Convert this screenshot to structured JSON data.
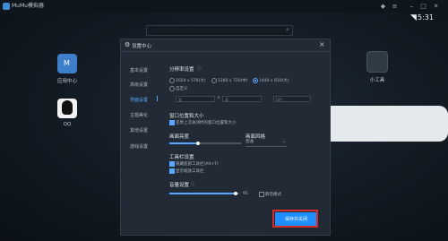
{
  "app": {
    "title": "MuMu模拟器"
  },
  "status": {
    "time": "5:31"
  },
  "desktop": {
    "app_center": "应用中心",
    "qq": "QQ",
    "tools": "小工具"
  },
  "dialog": {
    "title": "设置中心",
    "nav": [
      "基本设置",
      "高级设置",
      "界面设置",
      "主题美化",
      "其他设置",
      "游戏设置"
    ],
    "resolution": {
      "label": "分辨率设置",
      "options": [
        "1024 x 576(大)",
        "1280 x 720(中)",
        "1440 x 810(大)"
      ],
      "custom": "自定义",
      "selected_index": 2,
      "w_placeholder": "宽",
      "h_placeholder": "高",
      "dpi_placeholder": "DPI"
    },
    "window": {
      "label": "窗口位置和大小",
      "desc": "还原上次关闭时的窗口位置和大小"
    },
    "brightness": {
      "label": "画面亮度",
      "value": 0.4
    },
    "quality": {
      "label": "画面风格",
      "value": "普通"
    },
    "toolbar": {
      "label": "工具栏设置",
      "options": [
        "隐藏底部工具栏(Alt+T)",
        "显示缩放工具栏"
      ],
      "checked": [
        true,
        true
      ]
    },
    "volume": {
      "label": "音量设置",
      "value": 0.95,
      "value_text": "95",
      "mute": "静音模式"
    },
    "save_button": "保存并关闭"
  },
  "colors": {
    "accent": "#1f8fff",
    "highlight": "#d92b2b"
  }
}
